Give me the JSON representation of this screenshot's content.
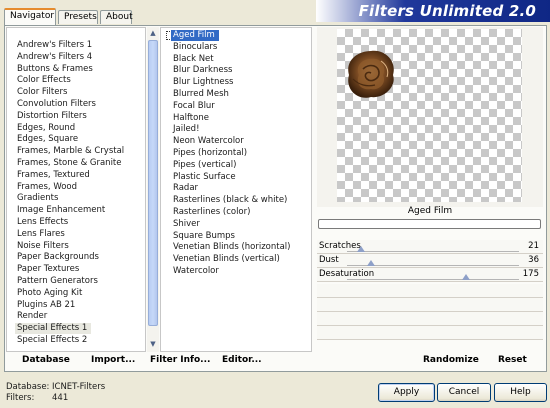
{
  "tabs": [
    "Navigator",
    "Presets",
    "About"
  ],
  "banner_title": "Filters Unlimited 2.0",
  "categories": [
    "Andrew's Filters 1",
    "Andrew's Filters 4",
    "Buttons & Frames",
    "Color Effects",
    "Color Filters",
    "Convolution Filters",
    "Distortion Filters",
    "Edges, Round",
    "Edges, Square",
    "Frames, Marble & Crystal",
    "Frames, Stone & Granite",
    "Frames, Textured",
    "Frames, Wood",
    "Gradients",
    "Image Enhancement",
    "Lens Effects",
    "Lens Flares",
    "Noise Filters",
    "Paper Backgrounds",
    "Paper Textures",
    "Pattern Generators",
    "Photo Aging Kit",
    "Plugins AB 21",
    "Render",
    "Special Effects 1",
    "Special Effects 2"
  ],
  "selected_category": "Special Effects 1",
  "filters": [
    "Aged Film",
    "Binoculars",
    "Black Net",
    "Blur Darkness",
    "Blur Lightness",
    "Blurred Mesh",
    "Focal Blur",
    "Halftone",
    "Jailed!",
    "Neon Watercolor",
    "Pipes (horizontal)",
    "Pipes (vertical)",
    "Plastic Surface",
    "Radar",
    "Rasterlines (black & white)",
    "Rasterlines (color)",
    "Shiver",
    "Square Bumps",
    "Venetian Blinds (horizontal)",
    "Venetian Blinds (vertical)",
    "Watercolor"
  ],
  "selected_filter": "Aged Film",
  "preview_filter_name": "Aged Film",
  "params": [
    {
      "label": "Scratches",
      "value": "21",
      "level": 0.08
    },
    {
      "label": "Dust",
      "value": "36",
      "level": 0.14
    },
    {
      "label": "Desaturation",
      "value": "175",
      "level": 0.69
    }
  ],
  "actions": {
    "database": "Database",
    "import": "Import...",
    "filter_info": "Filter Info...",
    "editor": "Editor...",
    "randomize": "Randomize",
    "reset": "Reset"
  },
  "status": {
    "database_label": "Database:",
    "database_value": "ICNET-Filters",
    "filters_label": "Filters:",
    "filters_value": "441"
  },
  "dialog": {
    "apply": "Apply",
    "cancel": "Cancel",
    "help": "Help"
  },
  "colors": {
    "selection": "#316ac5",
    "banner": "#0f2785",
    "tab_accent": "#e68b2c"
  }
}
